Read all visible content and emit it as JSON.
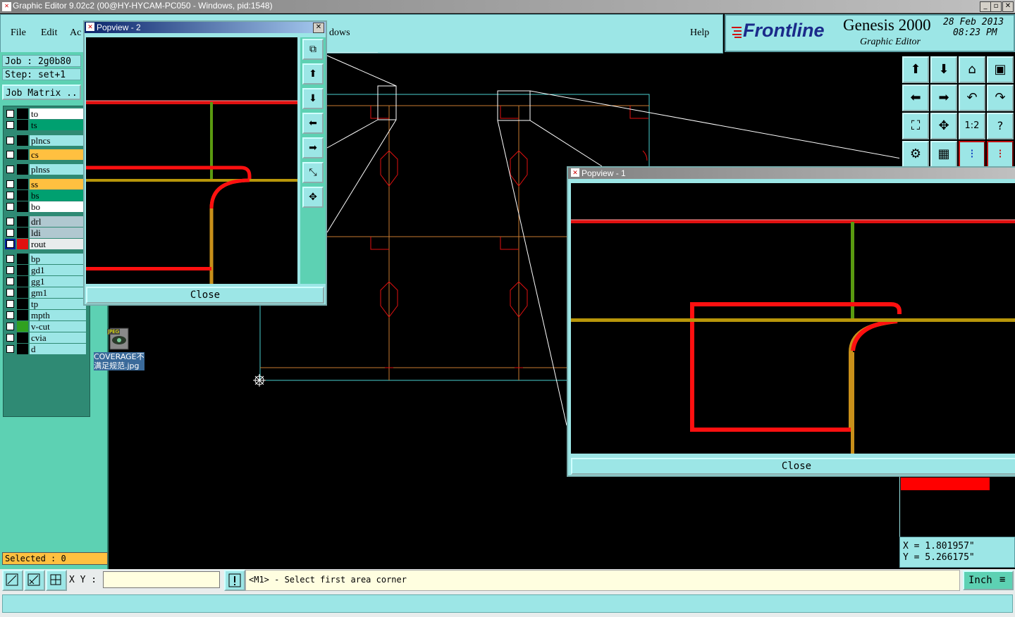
{
  "window": {
    "title": "Graphic Editor 9.02c2 (00@HY-HYCAM-PC050 - Windows, pid:1548)"
  },
  "menu": {
    "file": "File",
    "edit": "Edit",
    "actions": "Ac",
    "windows": "dows",
    "help": "Help"
  },
  "brand": {
    "logo": "Frontline",
    "product": "Genesis 2000",
    "subtitle": "Graphic Editor",
    "date": "28 Feb 2013",
    "time": "08:23 PM"
  },
  "job": {
    "job_label": "Job : 2g0b80",
    "step_label": "Step: set+1",
    "matrix_button": "Job Matrix .."
  },
  "layers": [
    {
      "name": "to",
      "color": "#ffffff"
    },
    {
      "name": "ts",
      "color": "#00a070"
    },
    {
      "name": "plncs",
      "color": "#9ce6e6"
    },
    {
      "name": "cs",
      "color": "#ffc040"
    },
    {
      "name": "plnss",
      "color": "#9ce6e6"
    },
    {
      "name": "ss",
      "color": "#ffc040"
    },
    {
      "name": "bs",
      "color": "#00a070"
    },
    {
      "name": "bo",
      "color": "#ffffff"
    },
    {
      "name": "drl",
      "color": "#b0c8d0"
    },
    {
      "name": "ldi",
      "color": "#b0c8d0"
    },
    {
      "name": "rout",
      "color": "#e8ecec"
    },
    {
      "name": "bp",
      "color": "#9ce6e6"
    },
    {
      "name": "gd1",
      "color": "#9ce6e6"
    },
    {
      "name": "gg1",
      "color": "#9ce6e6"
    },
    {
      "name": "gm1",
      "color": "#9ce6e6"
    },
    {
      "name": "tp",
      "color": "#9ce6e6"
    },
    {
      "name": "mpth",
      "color": "#9ce6e6"
    },
    {
      "name": "v-cut",
      "color": "#9ce6e6"
    },
    {
      "name": "cvia",
      "color": "#9ce6e6"
    },
    {
      "name": "d",
      "color": "#9ce6e6"
    }
  ],
  "desktop_icon": {
    "badge": "JPEG",
    "label": "COVERAGE不满足规范.jpg"
  },
  "selected": "Selected : 0",
  "popview2": {
    "title": "Popview - 2",
    "close": "Close"
  },
  "popview1": {
    "title": "Popview - 1",
    "close": "Close"
  },
  "coords": {
    "x": "X = 1.801957\"",
    "y": "Y = 5.266175\""
  },
  "status": {
    "xy_label": "X Y :",
    "xy_value": "",
    "message": "<M1> - Select first area corner",
    "units": "Inch"
  },
  "toolbar_icons": [
    "pan-up-icon",
    "pan-down-icon",
    "home-icon",
    "window-icon",
    "pan-left-icon",
    "pan-right-icon",
    "undo-icon",
    "redo-icon",
    "zoom-fit-icon",
    "zoom-center-icon",
    "zoom-1to2-icon",
    "help-icon",
    "measure-icon",
    "grid-icon",
    "snap-on-icon",
    "snap-off-icon"
  ],
  "zoom_labels": {
    "one_two": "1:2",
    "question": "?"
  }
}
